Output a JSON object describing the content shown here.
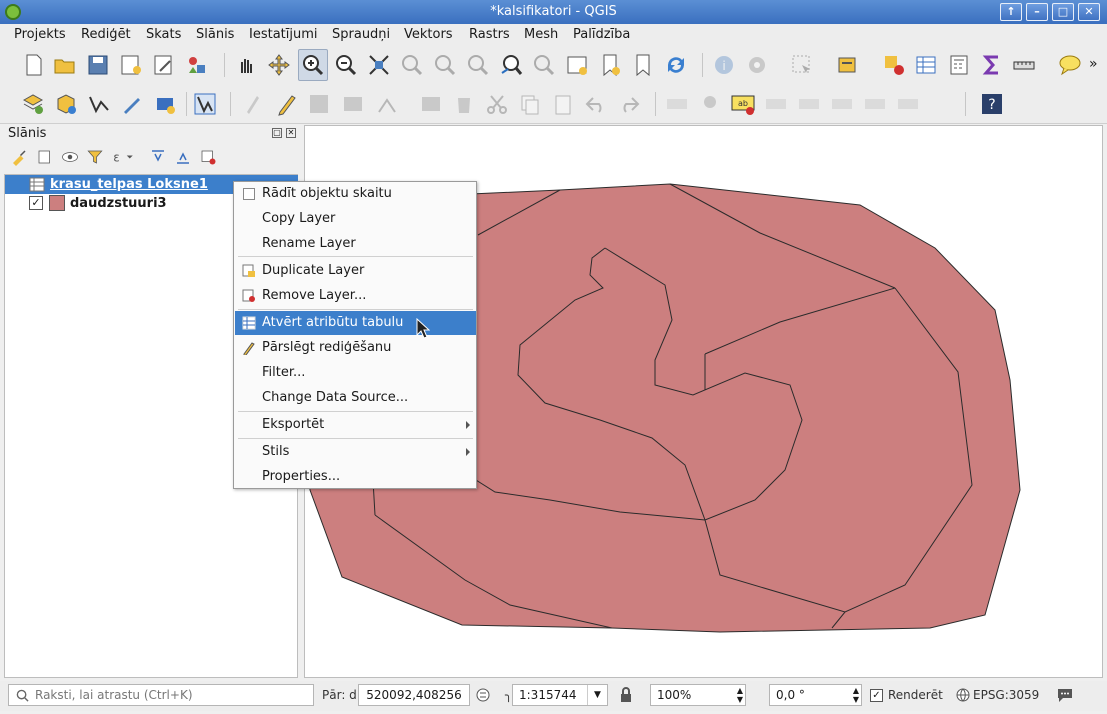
{
  "window": {
    "title": "*kalsifikatori - QGIS"
  },
  "menubar": [
    "Projekts",
    "Rediģēt",
    "Skats",
    "Slānis",
    "Iestatījumi",
    "Spraudņi",
    "Vektors",
    "Rastrs",
    "Mesh",
    "Palīdzība"
  ],
  "layers_panel": {
    "title": "Slānis",
    "layers": [
      {
        "name": "krasu_telpas Loksne1",
        "selected": true,
        "type": "table"
      },
      {
        "name": "daudzstuuri3",
        "checked": true,
        "color": "#cc7f7f"
      }
    ]
  },
  "context_menu": {
    "items": [
      {
        "label": "Rādīt objektu skaitu"
      },
      {
        "label": "Copy Layer"
      },
      {
        "label": "Rename Layer"
      },
      {
        "label": "Duplicate Layer"
      },
      {
        "label": "Remove Layer..."
      },
      {
        "label": "Atvērt atribūtu tabulu",
        "highlighted": true
      },
      {
        "label": "Pārslēgt rediģēšanu"
      },
      {
        "label": "Filter..."
      },
      {
        "label": "Change Data Source..."
      },
      {
        "label": "Eksportēt",
        "submenu": true
      },
      {
        "label": "Stils",
        "submenu": true
      },
      {
        "label": "Properties..."
      }
    ]
  },
  "statusbar": {
    "search_placeholder": "Raksti, lai atrastu (Ctrl+K)",
    "coord_label": "Pār: d",
    "coordinate": "520092,408256",
    "scale": "1:315744",
    "magnifier": "100%",
    "rotation": "0,0 °",
    "render_label": "Renderēt",
    "crs": "EPSG:3059"
  },
  "colors": {
    "polygon_fill": "#cc7f7f",
    "polygon_stroke": "#2b2b2b",
    "selection": "#3c7fcb",
    "titlebar": "#3a6fbf"
  }
}
